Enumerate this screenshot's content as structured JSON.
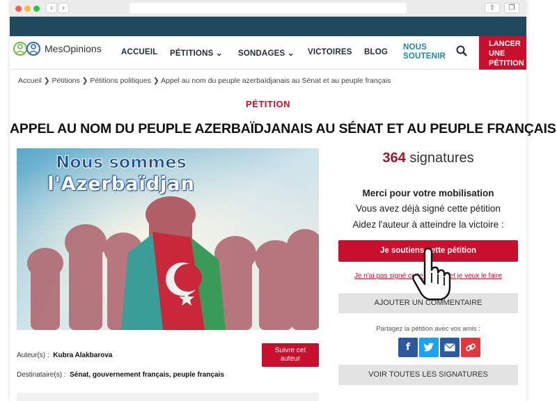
{
  "header": {
    "logo_text": "MesOpinions",
    "nav": {
      "accueil": "ACCUEIL",
      "petitions": "PÉTITIONS",
      "sondages": "SONDAGES",
      "victoires": "VICTOIRES",
      "blog": "BLOG",
      "nous1": "NOUS",
      "nous2": "SOUTENIR"
    },
    "launch": [
      "LANCER",
      "UNE",
      "PÉTITION"
    ]
  },
  "breadcrumb": "Accueil ❯ Pétitions ❯ Pétitions politiques ❯ Appel au nom du peuple azerbaïdjanais au Sénat et au peuple français",
  "petition_tag": "PÉTITION",
  "title": "APPEL AU NOM DU PEUPLE AZERBAÏDJANAIS AU SÉNAT ET AU PEUPLE FRANÇAIS",
  "hero": {
    "line1": "Nous sommes",
    "line2": "l'Azerbaïdjan"
  },
  "meta": {
    "author_label": "Auteur(s) :",
    "author": "Kubra Alakbarova",
    "recipient_label": "Destinataire(s) :",
    "recipients": "Sénat, gouvernement français, peuple français",
    "follow_1": "Suivre cet",
    "follow_2": "auteur"
  },
  "signatures": {
    "count": "364",
    "label": "signatures"
  },
  "mobilisation": {
    "heading": "Merci pour votre mobilisation",
    "line1": "Vous avez déjà signé cette pétition",
    "line2": "Aidez l'auteur à atteindre la victoire :"
  },
  "actions": {
    "support": "Je soutiens cette pétition",
    "not_signed": "Je n'ai pas signé cette pétition et je veux le faire",
    "comment": "AJOUTER UN COMMENTAIRE",
    "share": "Partagez la pétition avec vos amis :",
    "all_signatures": "VOIR TOUTES LES SIGNATURES"
  },
  "colors": {
    "brand_red": "#c8102e",
    "header_dark": "#1e4a5c",
    "facebook": "#2d5a9e",
    "twitter": "#1da1f2",
    "email": "#2c5aa0",
    "link": "#e03a3e"
  },
  "icons": [
    "facebook-icon",
    "twitter-icon",
    "email-icon",
    "link-icon",
    "search-icon",
    "hand-cursor-icon"
  ]
}
